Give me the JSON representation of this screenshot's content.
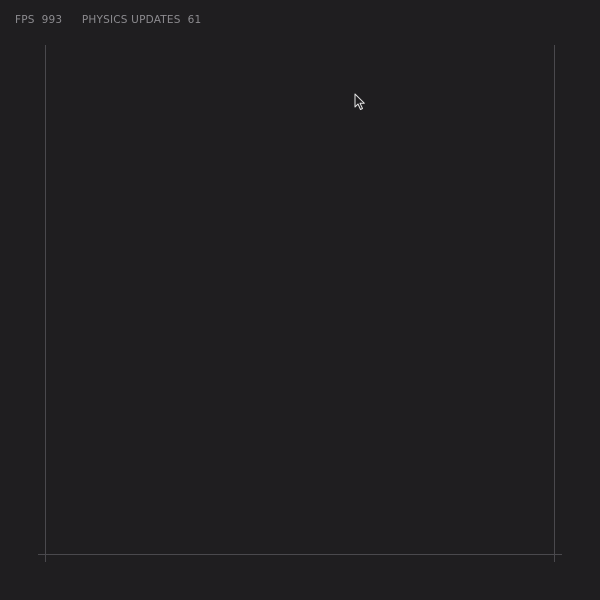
{
  "hud": {
    "fps_label": "FPS",
    "fps_value": "993",
    "physics_label": "PHYSICS UPDATES",
    "physics_value": "61"
  },
  "colors": {
    "background": "#1f1e20",
    "hud_text": "#8c8b8f",
    "boundary_line": "#4a494d",
    "cursor_outline": "#e6e6e6"
  },
  "icons": {
    "cursor": "mouse-pointer-icon"
  }
}
